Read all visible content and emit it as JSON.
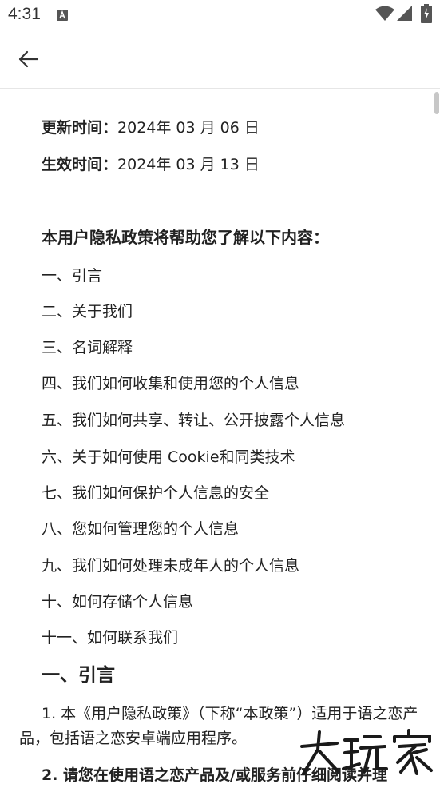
{
  "status_bar": {
    "time": "4:31",
    "icons": [
      "notification-a-icon",
      "wifi-icon",
      "signal-icon",
      "battery-icon"
    ]
  },
  "app_bar": {
    "back_icon": "arrow-left-icon"
  },
  "policy": {
    "updated_label": "更新时间：",
    "updated_value": "2024年 03 月 06 日",
    "effective_label": "生效时间：",
    "effective_value": "2024年 03 月 13 日",
    "intro_heading": "本用户隐私政策将帮助您了解以下内容：",
    "toc": [
      "一、引言",
      "二、关于我们",
      "三、名词解释",
      "四、我们如何收集和使用您的个人信息",
      "五、我们如何共享、转让、公开披露个人信息",
      "六、关于如何使用 Cookie和同类技术",
      "七、我们如何保护个人信息的安全",
      "八、您如何管理您的个人信息",
      "九、我们如何处理未成年人的个人信息",
      "十、如何存储个人信息",
      "十一、如何联系我们"
    ],
    "section1_heading": "一、引言",
    "para1": "1. 本《用户隐私政策》（下称“本政策”）适用于语之恋产品，包括语之恋安卓端应用程序。",
    "para2": "2. 请您在使用语之恋产品及/或服务前仔细阅读并理"
  },
  "watermark": {
    "text": "大玩家"
  },
  "colors": {
    "text": "#222222",
    "divider": "#e6e6e6",
    "scrollbar": "#c7c7c7",
    "background": "#ffffff"
  }
}
